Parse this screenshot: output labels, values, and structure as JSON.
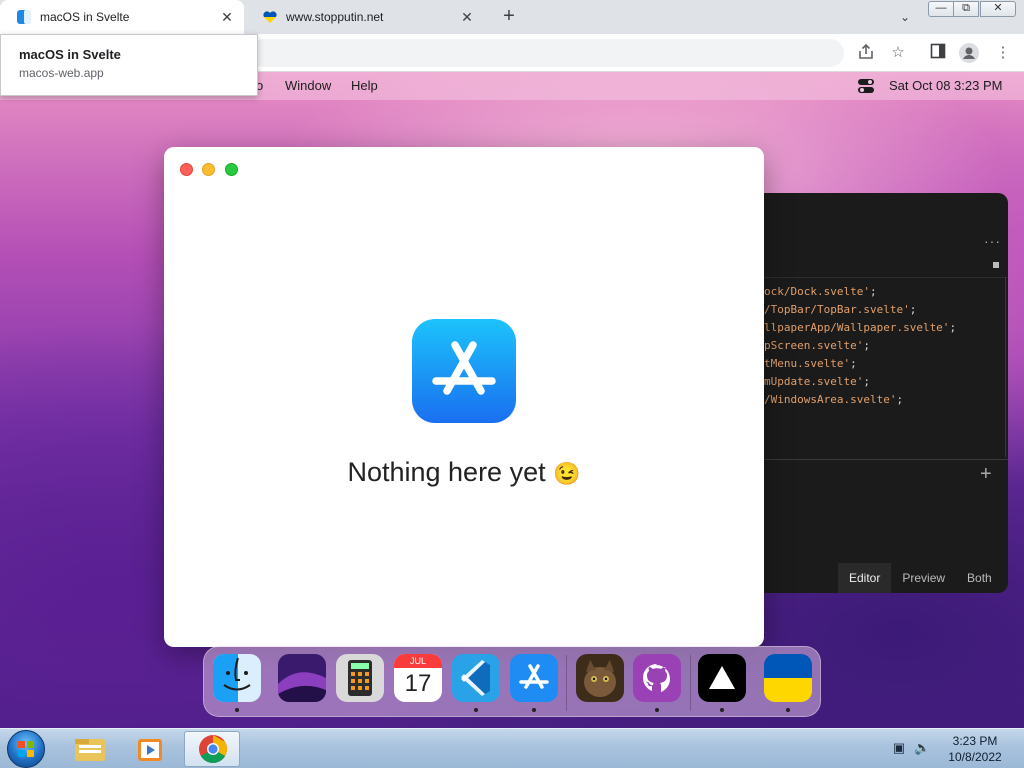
{
  "browser": {
    "tabs": [
      {
        "title": "macOS in Svelte",
        "active": true
      },
      {
        "title": "www.stopputin.net",
        "active": false
      }
    ],
    "tooltip": {
      "title": "macOS in Svelte",
      "url": "macos-web.app"
    },
    "window_controls": {
      "minimize": "—",
      "maximize": "⧉",
      "close": "✕"
    }
  },
  "macos": {
    "menubar": {
      "items": [
        "o",
        "Window",
        "Help"
      ],
      "datetime": "Sat Oct 08   3:23 PM"
    },
    "appstore_window": {
      "message": "Nothing here yet",
      "emoji": "😉"
    },
    "code_window": {
      "more": "···",
      "lines": [
        {
          "str": "ock/Dock.svelte'",
          "punc": ";"
        },
        {
          "str": "/TopBar/TopBar.svelte'",
          "punc": ";"
        },
        {
          "str": "llpaperApp/Wallpaper.svelte'",
          "punc": ";"
        },
        {
          "str": "pScreen.svelte'",
          "punc": ";"
        },
        {
          "str": "tMenu.svelte'",
          "punc": ";"
        },
        {
          "str": "mUpdate.svelte'",
          "punc": ";"
        },
        {
          "str": "/WindowsArea.svelte'",
          "punc": ";"
        }
      ],
      "tabs": [
        "Editor",
        "Preview",
        "Both"
      ],
      "active_tab": "Editor"
    },
    "dock": {
      "items": [
        {
          "name": "Finder",
          "icon": "finder-icon",
          "running": true
        },
        {
          "name": "Wallpapers",
          "icon": "wallpapers-icon",
          "running": false
        },
        {
          "name": "Calculator",
          "icon": "calculator-icon",
          "running": false
        },
        {
          "name": "Calendar",
          "icon": "calendar-icon",
          "running": false,
          "month": "JUL",
          "day": "17"
        },
        {
          "name": "VS Code",
          "icon": "vscode-icon",
          "running": true
        },
        {
          "name": "App Store",
          "icon": "appstore-icon",
          "running": true
        },
        {
          "name": "Purrr",
          "icon": "cat-photo-icon",
          "running": false
        },
        {
          "name": "GitHub",
          "icon": "github-icon",
          "running": true
        },
        {
          "name": "Vercel",
          "icon": "vercel-icon",
          "running": true
        },
        {
          "name": "Ukraine",
          "icon": "ukraine-flag-icon",
          "running": true
        }
      ]
    }
  },
  "taskbar": {
    "time": "3:23 PM",
    "date": "10/8/2022",
    "pinned": [
      "windows-explorer-icon",
      "media-player-icon",
      "chrome-icon"
    ],
    "active": "chrome-icon"
  },
  "colors": {
    "accent_blue": "#0a7cf5",
    "traffic_red": "#fe5f57",
    "traffic_yellow": "#febc2e",
    "traffic_green": "#28c840",
    "ukraine_blue": "#0057b7",
    "ukraine_yellow": "#ffd700"
  }
}
